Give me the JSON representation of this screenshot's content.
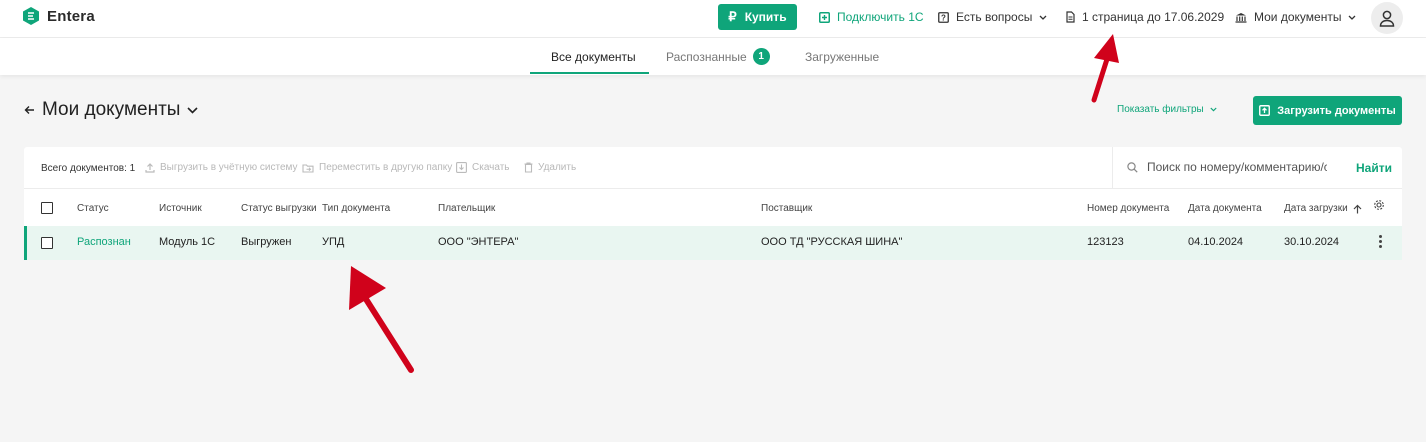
{
  "app": {
    "name": "Entera"
  },
  "header": {
    "buy_label": "Купить",
    "buy_icon": "ruble-icon",
    "connect_label": "Подключить 1С",
    "questions_label": "Есть вопросы",
    "plan_label": "1 страница до 17.06.2029",
    "docs_menu_label": "Мои документы",
    "accent_color": "#0fa57a"
  },
  "tabs": [
    {
      "label": "Все документы",
      "active": true
    },
    {
      "label": "Распознанные",
      "badge": "1"
    },
    {
      "label": "Загруженные"
    }
  ],
  "page": {
    "title": "Мои документы",
    "show_filters_label": "Показать фильтры",
    "upload_label": "Загрузить документы"
  },
  "toolbar": {
    "total": "Всего документов: 1",
    "export_label": "Выгрузить в учётную систему",
    "move_label": "Переместить в другую папку",
    "download_label": "Скачать",
    "delete_label": "Удалить"
  },
  "search": {
    "placeholder": "Поиск по номеру/комментарию/сумме",
    "button_label": "Найти"
  },
  "table": {
    "columns": [
      "Статус",
      "Источник",
      "Статус выгрузки",
      "Тип документа",
      "Плательщик",
      "Поставщик",
      "Номер документа",
      "Дата документа",
      "Дата загрузки"
    ],
    "rows": [
      {
        "status": "Распознан",
        "source": "Модуль 1С",
        "export_status": "Выгружен",
        "doc_type": "УПД",
        "payer": "ООО \"ЭНТЕРА\"",
        "supplier": "ООО ТД \"РУССКАЯ ШИНА\"",
        "doc_number": "123123",
        "doc_date": "04.10.2024",
        "upload_date": "30.10.2024"
      }
    ]
  },
  "annotations": {
    "arrow_color": "#d0021b"
  }
}
